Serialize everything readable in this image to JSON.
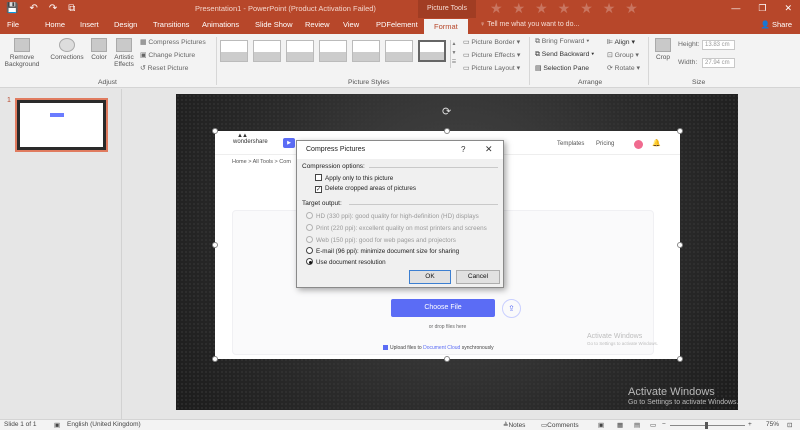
{
  "titlebar": {
    "title": "Presentation1 - PowerPoint (Product Activation Failed)",
    "context_tab_group": "Picture Tools",
    "qat": {
      "save": "💾",
      "undo": "↶",
      "redo": "↷",
      "present": "⧉"
    },
    "window": {
      "minimize": "—",
      "restore": "❐",
      "close": "✕"
    }
  },
  "tabs": [
    "File",
    "Home",
    "Insert",
    "Design",
    "Transitions",
    "Animations",
    "Slide Show",
    "Review",
    "View",
    "PDFelement",
    "Format"
  ],
  "tellme": "Tell me what you want to do...",
  "share": "Share",
  "ribbon": {
    "adjust": {
      "remove_background": "Remove Background",
      "corrections": "Corrections",
      "color": "Color",
      "artistic_effects": "Artistic Effects",
      "compress": "Compress Pictures",
      "change": "Change Picture",
      "reset": "Reset Picture",
      "label": "Adjust"
    },
    "picture_styles": {
      "label": "Picture Styles",
      "border": "Picture Border",
      "effects": "Picture Effects",
      "layout": "Picture Layout"
    },
    "arrange": {
      "label": "Arrange",
      "bring_forward": "Bring Forward",
      "send_backward": "Send Backward",
      "selection_pane": "Selection Pane",
      "align": "Align",
      "group": "Group",
      "rotate": "Rotate"
    },
    "size": {
      "label": "Size",
      "crop": "Crop",
      "height_label": "Height:",
      "height_value": "13.83 cm",
      "width_label": "Width:",
      "width_value": "27.94 cm"
    }
  },
  "thumbnail": {
    "number": "1"
  },
  "web": {
    "brand": "wondershare",
    "nav_templates": "Templates",
    "nav_pricing": "Pricing",
    "breadcrumb": "Home > All Tools > Com",
    "choose_file": "Choose File",
    "drop_hint": "or drop files here",
    "cloud_prefix": "Upload files to",
    "cloud_link": "Document Cloud",
    "cloud_suffix": "synchronously",
    "activate_title": "Activate Windows",
    "activate_sub": "Go to Settings to activate Windows."
  },
  "dialog": {
    "title": "Compress Pictures",
    "help": "?",
    "close": "✕",
    "compression_header": "Compression options:",
    "apply_only": "Apply only to this picture",
    "apply_only_checked": false,
    "delete_cropped": "Delete cropped areas of pictures",
    "delete_cropped_checked": true,
    "target_header": "Target output:",
    "options": [
      {
        "label": "HD (330 ppi): good quality for high-definition (HD) displays",
        "enabled": false,
        "selected": false
      },
      {
        "label": "Print (220 ppi): excellent quality on most printers and screens",
        "enabled": false,
        "selected": false
      },
      {
        "label": "Web (150 ppi): good for web pages and projectors",
        "enabled": false,
        "selected": false
      },
      {
        "label": "E-mail (96 ppi): minimize document size for sharing",
        "enabled": true,
        "selected": false
      },
      {
        "label": "Use document resolution",
        "enabled": true,
        "selected": true
      }
    ],
    "ok": "OK",
    "cancel": "Cancel"
  },
  "watermark": {
    "title": "Activate Windows",
    "sub": "Go to Settings to activate Windows."
  },
  "status": {
    "slide": "Slide 1 of 1",
    "language": "English (United Kingdom)",
    "notes": "Notes",
    "comments": "Comments",
    "zoom": "75%"
  },
  "colors": {
    "accent": "#b7472a",
    "web_primary": "#5b6cf5"
  }
}
